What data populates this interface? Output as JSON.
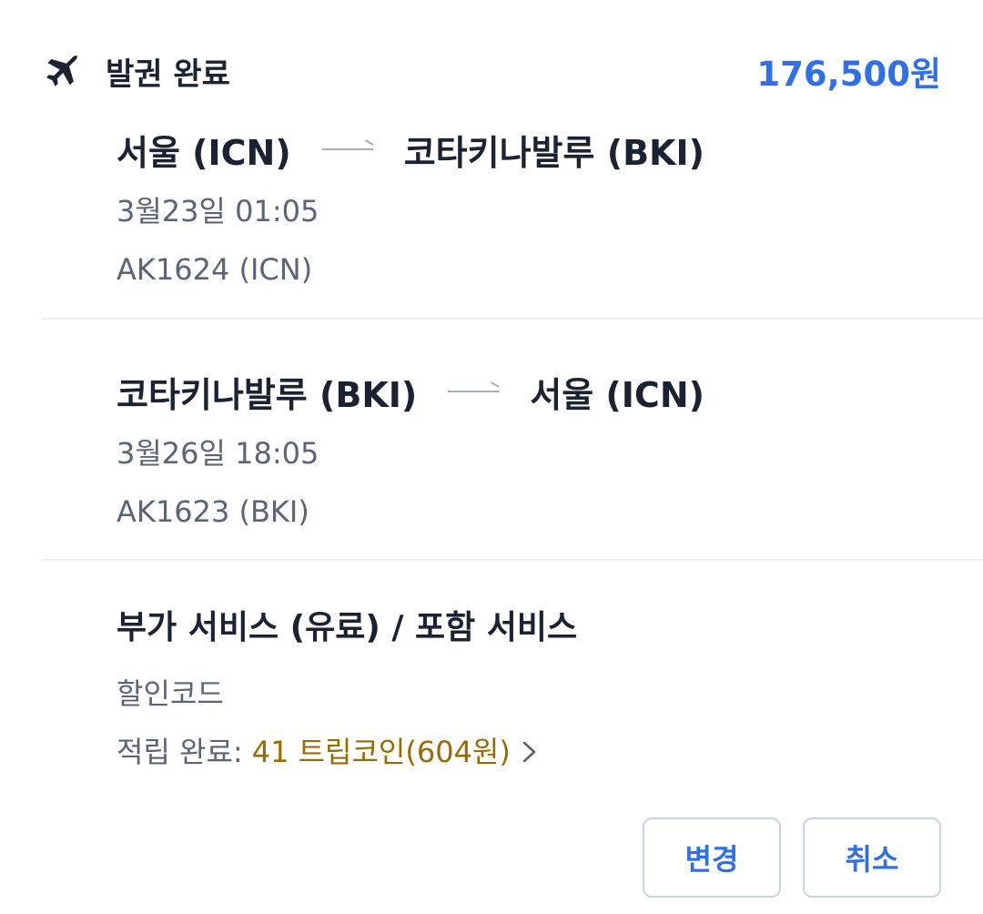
{
  "header": {
    "icon": "airplane-icon",
    "status": "발권 완료",
    "total_price": "176,500원",
    "price_color": "#2f6fe8"
  },
  "segments": [
    {
      "origin": "서울 (ICN)",
      "destination": "코타키나발루 (BKI)",
      "datetime": "3월23일 01:05",
      "flight": "AK1624 (ICN)"
    },
    {
      "origin": "코타키나발루 (BKI)",
      "destination": "서울 (ICN)",
      "datetime": "3월26일 18:05",
      "flight": "AK1623 (BKI)"
    }
  ],
  "services": {
    "title": "부가 서비스 (유료) / 포함 서비스",
    "discount_code": "할인코드",
    "earned_label": "적립 완료:",
    "earned_value": "41 트립코인(604원)",
    "earned_color": "#9a6b00"
  },
  "actions": {
    "change_label": "변경",
    "cancel_label": "취소"
  }
}
